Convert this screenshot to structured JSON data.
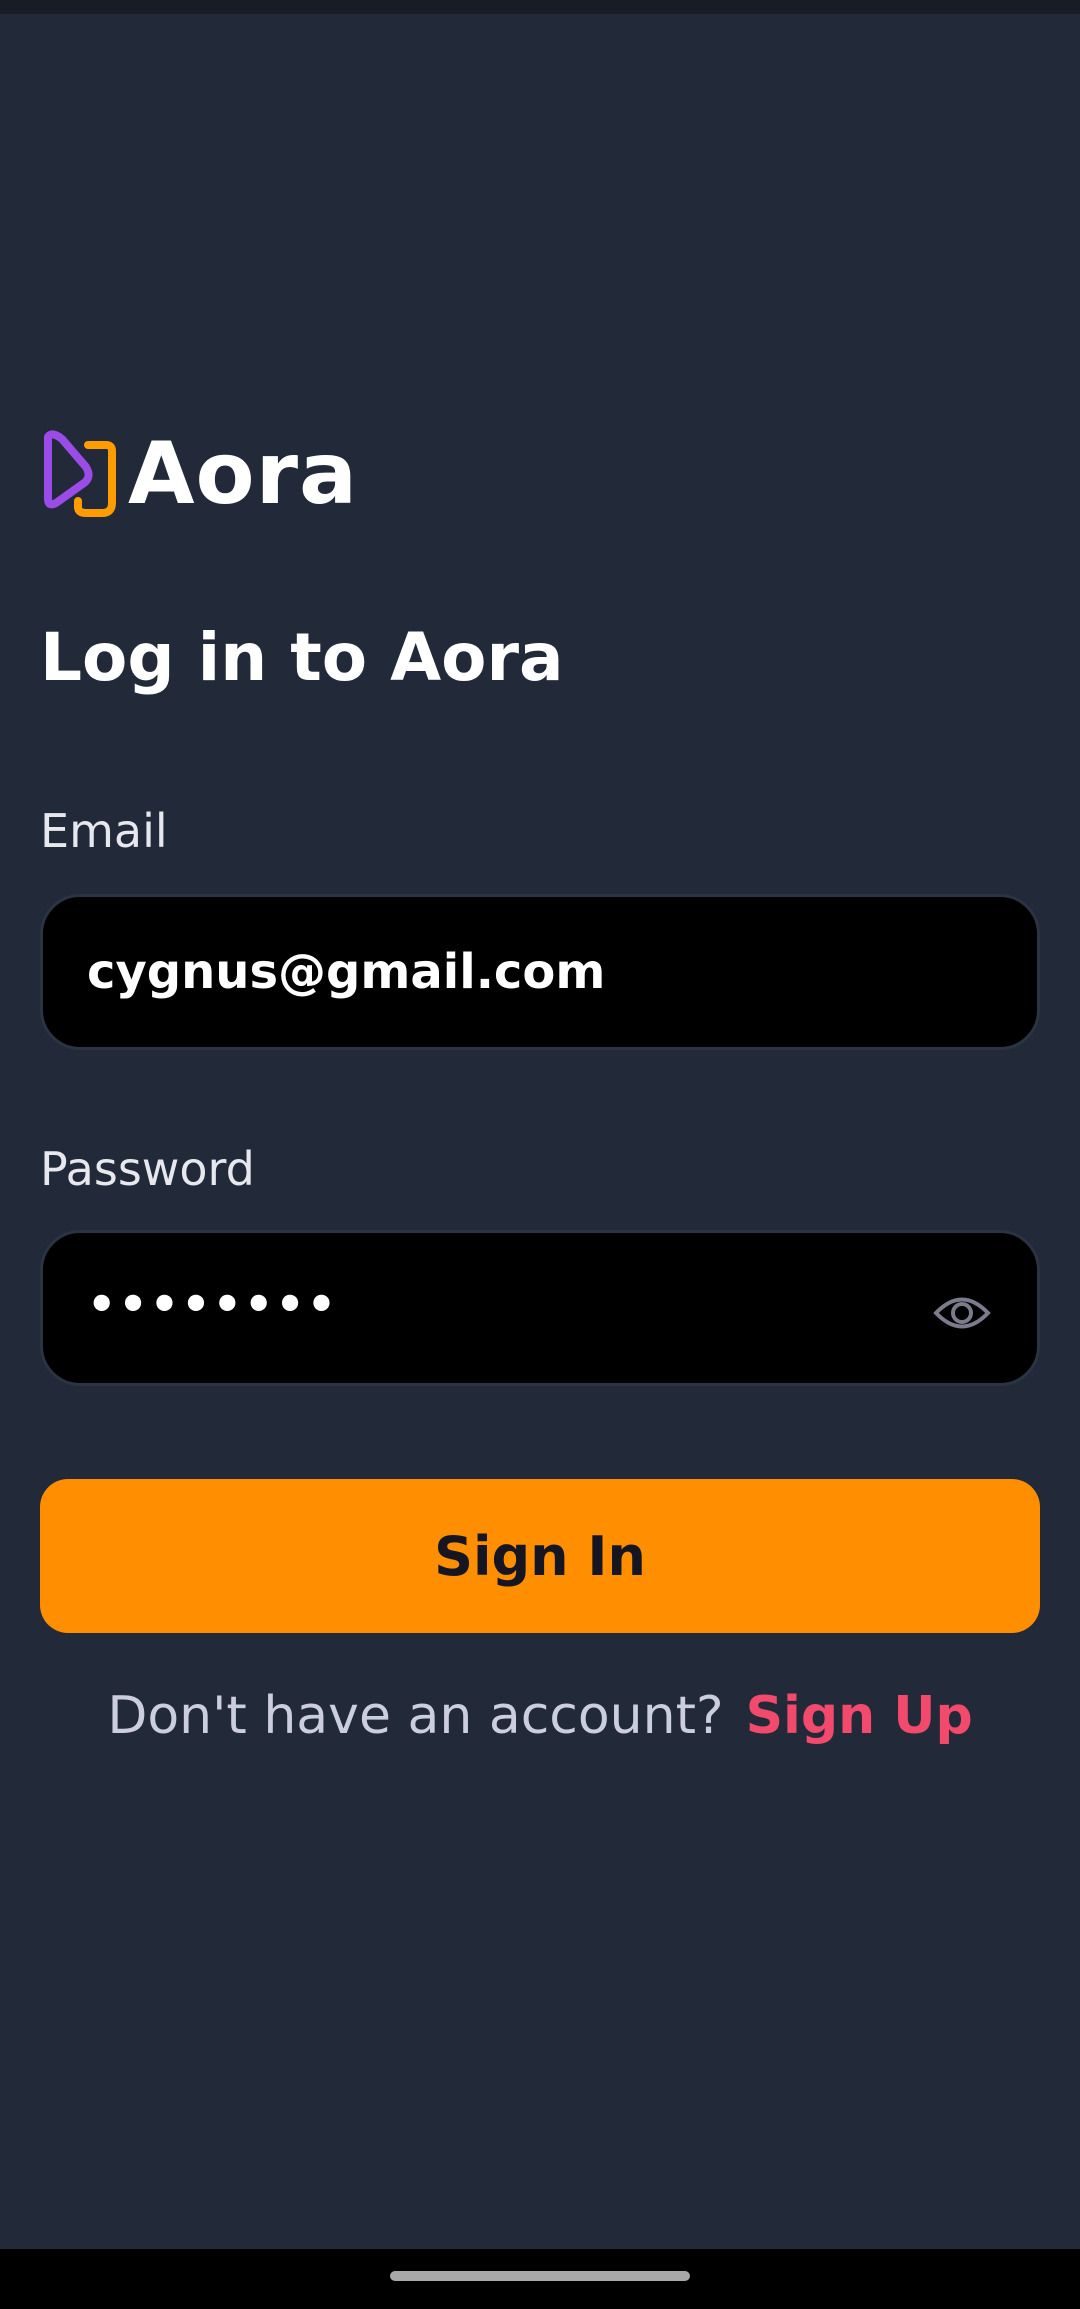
{
  "app": {
    "name": "Aora",
    "logo_colors": {
      "primary": "#9b4be8",
      "secondary": "#ff9c01"
    }
  },
  "login": {
    "title": "Log in to Aora",
    "email_label": "Email",
    "email_value": "cygnus@gmail.com",
    "password_label": "Password",
    "password_mask": "••••••••",
    "password_toggle_icon": "eye-icon",
    "signin_label": "Sign In",
    "signup_prompt": "Don't have an account?",
    "signup_link": "Sign Up"
  },
  "colors": {
    "background": "#222938",
    "accent": "#ff8e01",
    "link": "#f14a6c",
    "input_bg": "#000000"
  }
}
